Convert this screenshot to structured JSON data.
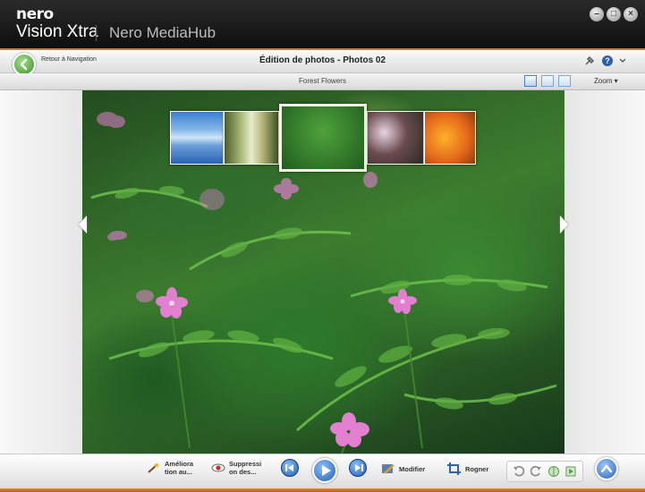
{
  "window": {
    "brand": "nero",
    "product": "Vision Xtra",
    "hub": "Nero MediaHub",
    "controls": [
      "minimize-icon",
      "maximize-icon",
      "close-icon"
    ]
  },
  "nav": {
    "back_label": "Retour à Navigation",
    "title": "Édition de photos - Photos 02"
  },
  "subbar": {
    "album": "Forest Flowers",
    "zoom_label": "Zoom"
  },
  "filmstrip": {
    "thumbnails": [
      "blue-ice",
      "forest-path",
      "pink-flowers",
      "white-flowers",
      "orange-flowers"
    ],
    "selected_index": 2
  },
  "bottom": {
    "enhance": "Améliora tion au...",
    "enhance_line1": "Améliora",
    "enhance_line2": "tion au...",
    "redeye": "Suppressi on des...",
    "redeye_line1": "Suppressi",
    "redeye_line2": "on des...",
    "modify": "Modifier",
    "crop": "Rogner"
  },
  "colors": {
    "accent": "#d9781f",
    "play_blue": "#1f5fb4",
    "back_green": "#3f8f2c"
  }
}
